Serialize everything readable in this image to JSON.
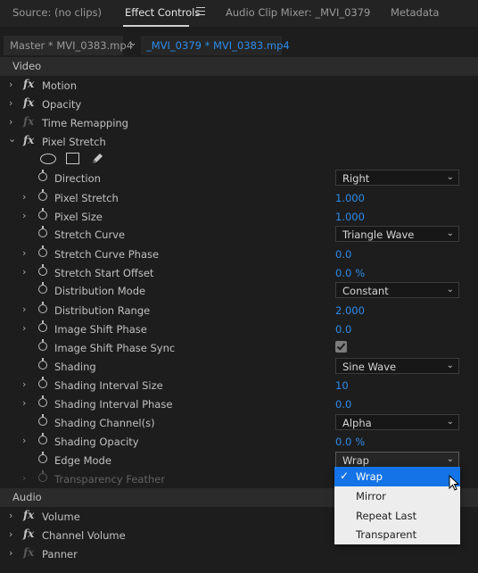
{
  "tabs": [
    {
      "label": "Source: (no clips)"
    },
    {
      "label": "Effect Controls"
    },
    {
      "label": "Audio Clip Mixer: _MVI_0379"
    },
    {
      "label": "Metadata"
    }
  ],
  "clip": {
    "master": "Master * MVI_0383.mp4",
    "sequence": "_MVI_0379 * MVI_0383.mp4"
  },
  "video_header": "Video",
  "audio_header": "Audio",
  "video_effects": [
    {
      "label": "Motion"
    },
    {
      "label": "Opacity"
    },
    {
      "label": "Time Remapping"
    },
    {
      "label": "Pixel Stretch"
    }
  ],
  "params": [
    {
      "label": "Direction",
      "value": "Right"
    },
    {
      "label": "Pixel Stretch",
      "value": "1.000"
    },
    {
      "label": "Pixel Size",
      "value": "1.000"
    },
    {
      "label": "Stretch Curve",
      "value": "Triangle Wave"
    },
    {
      "label": "Stretch Curve Phase",
      "value": "0.0"
    },
    {
      "label": "Stretch Start Offset",
      "value": "0.0",
      "unit": "%"
    },
    {
      "label": "Distribution Mode",
      "value": "Constant"
    },
    {
      "label": "Distribution Range",
      "value": "2.000"
    },
    {
      "label": "Image Shift Phase",
      "value": "0.0"
    },
    {
      "label": "Image Shift Phase Sync",
      "checked": true
    },
    {
      "label": "Shading",
      "value": "Sine Wave"
    },
    {
      "label": "Shading Interval Size",
      "value": "10"
    },
    {
      "label": "Shading Interval Phase",
      "value": "0.0"
    },
    {
      "label": "Shading Channel(s)",
      "value": "Alpha"
    },
    {
      "label": "Shading Opacity",
      "value": "0.0",
      "unit": "%"
    },
    {
      "label": "Edge Mode",
      "value": "Wrap"
    },
    {
      "label": "Transparency Feather"
    }
  ],
  "audio_effects": [
    {
      "label": "Volume"
    },
    {
      "label": "Channel Volume"
    },
    {
      "label": "Panner"
    }
  ],
  "edge_mode_menu": {
    "options": [
      "Wrap",
      "Mirror",
      "Repeat Last",
      "Transparent"
    ],
    "selected": "Wrap"
  },
  "icons": {
    "fx": "fx",
    "expand": "›",
    "collapse": "⌄",
    "dropdown": "⌄",
    "check": "✓"
  },
  "colors": {
    "accent": "#2d8ceb",
    "menu_highlight": "#1473e6"
  }
}
